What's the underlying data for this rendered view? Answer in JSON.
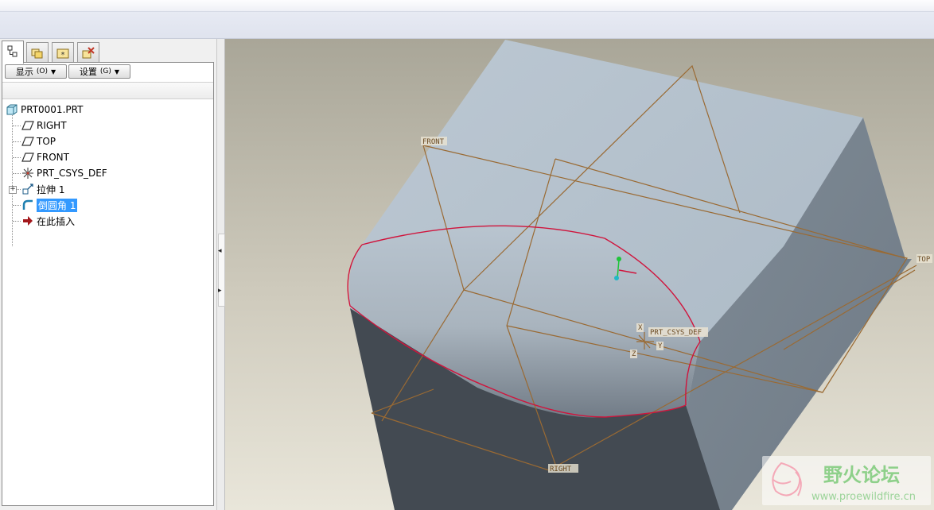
{
  "toolbar": {
    "show_label": "显示",
    "show_key": "(O)",
    "settings_label": "设置",
    "settings_key": "(G)"
  },
  "tree": {
    "root": "PRT0001.PRT",
    "items": [
      {
        "label": "RIGHT",
        "icon": "datum-plane-icon"
      },
      {
        "label": "TOP",
        "icon": "datum-plane-icon"
      },
      {
        "label": "FRONT",
        "icon": "datum-plane-icon"
      },
      {
        "label": "PRT_CSYS_DEF",
        "icon": "coordinate-system-icon"
      },
      {
        "label": "拉伸 1",
        "icon": "extrude-icon"
      },
      {
        "label": "倒圆角 1",
        "icon": "round-icon",
        "selected": true
      },
      {
        "label": "在此插入",
        "icon": "insert-here-arrow-icon"
      }
    ]
  },
  "viewport": {
    "datum_labels": {
      "front": "FRONT",
      "top": "TOP",
      "right": "RIGHT",
      "csys": "PRT_CSYS_DEF",
      "axis_x": "X",
      "axis_y": "Y",
      "axis_z": "Z"
    },
    "watermark": {
      "title": "野火论坛",
      "url": "www.proewildfire.cn"
    }
  },
  "colors": {
    "datum": "#9a6a33",
    "selection": "#d0143c",
    "block_top": "#b6c3cf",
    "block_side": "#7a8691",
    "block_front": "#424a53",
    "bg_top": "#a9a698",
    "bg_bottom": "#e9e6da"
  }
}
